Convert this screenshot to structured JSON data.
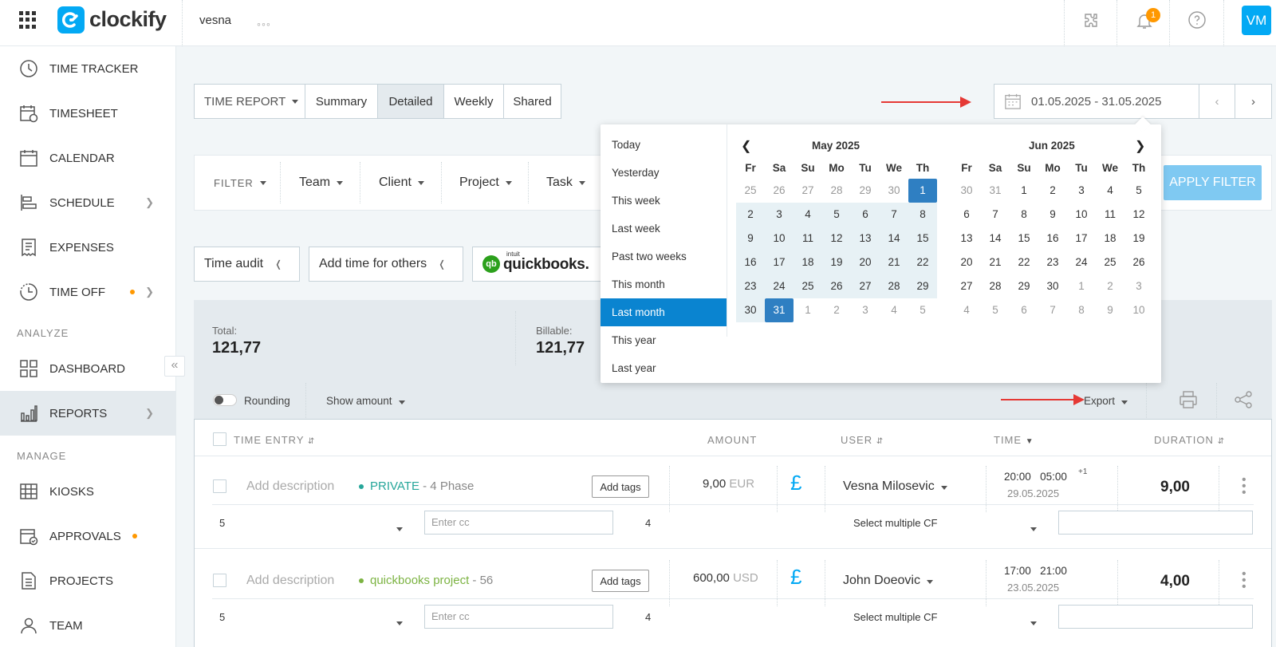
{
  "header": {
    "app_name": "clockify",
    "workspace": "vesna",
    "more": "◦◦◦",
    "notif_count": "1",
    "avatar": "VM"
  },
  "sidebar": {
    "items": [
      {
        "label": "TIME TRACKER",
        "icon": "clock-icon"
      },
      {
        "label": "TIMESHEET",
        "icon": "timesheet-icon"
      },
      {
        "label": "CALENDAR",
        "icon": "calendar-icon"
      },
      {
        "label": "SCHEDULE",
        "icon": "schedule-icon"
      },
      {
        "label": "EXPENSES",
        "icon": "receipt-icon"
      },
      {
        "label": "TIME OFF",
        "icon": "time-off-icon"
      },
      {
        "label": "DASHBOARD",
        "icon": "dashboard-icon"
      },
      {
        "label": "REPORTS",
        "icon": "reports-icon"
      },
      {
        "label": "KIOSKS",
        "icon": "kiosk-icon"
      },
      {
        "label": "APPROVALS",
        "icon": "approvals-icon"
      },
      {
        "label": "PROJECTS",
        "icon": "projects-icon"
      },
      {
        "label": "TEAM",
        "icon": "team-icon"
      }
    ],
    "section_analyze": "ANALYZE",
    "section_manage": "MANAGE",
    "collapse": "«"
  },
  "report": {
    "type_label": "TIME REPORT",
    "tabs": [
      "Summary",
      "Detailed",
      "Weekly",
      "Shared"
    ],
    "active_tab": "Detailed",
    "date_range": "01.05.2025 - 31.05.2025"
  },
  "filter": {
    "label": "FILTER",
    "items": [
      "Team",
      "Client",
      "Project",
      "Task"
    ],
    "apply": "APPLY FILTER"
  },
  "tools": {
    "time_audit": "Time audit",
    "add_time": "Add time for others",
    "qb_intuit": "intuit",
    "qb_name": "quickbooks."
  },
  "totals": {
    "total_label": "Total:",
    "total_value": "121,77",
    "billable_label": "Billable:",
    "billable_value": "121,77"
  },
  "options": {
    "rounding": "Rounding",
    "show_amount": "Show amount",
    "export": "Export"
  },
  "table": {
    "headers": {
      "entry": "TIME ENTRY",
      "amount": "AMOUNT",
      "user": "USER",
      "time": "TIME",
      "duration": "DURATION"
    },
    "rows": [
      {
        "description": "Add description",
        "project": "PRIVATE",
        "task": "- 4 Phase",
        "project_color": "#26a69a",
        "tags": "Add tags",
        "amount": "9,00",
        "currency": "EUR",
        "billable": "£",
        "user": "Vesna Milosevic",
        "start": "20:00",
        "end": "05:00",
        "plus": "+1",
        "date": "29.05.2025",
        "duration": "9,00",
        "cf_num": "5",
        "cf_text": "Enter cc",
        "cf_val": "4",
        "cf_multi": "Select multiple CF"
      },
      {
        "description": "Add description",
        "project": "quickbooks project",
        "task": "- 56",
        "project_color": "#7cb342",
        "tags": "Add tags",
        "amount": "600,00",
        "currency": "USD",
        "billable": "£",
        "user": "John Doeovic",
        "start": "17:00",
        "end": "21:00",
        "plus": "",
        "date": "23.05.2025",
        "duration": "4,00",
        "cf_num": "5",
        "cf_text": "Enter cc",
        "cf_val": "4",
        "cf_multi": "Select multiple CF"
      }
    ]
  },
  "datepicker": {
    "presets": [
      "Today",
      "Yesterday",
      "This week",
      "Last week",
      "Past two weeks",
      "This month",
      "Last month",
      "This year",
      "Last year"
    ],
    "selected_preset": "Last month",
    "weekdays": [
      "Fr",
      "Sa",
      "Su",
      "Mo",
      "Tu",
      "We",
      "Th"
    ],
    "left": {
      "title": "May 2025",
      "weeks": [
        [
          "25",
          "26",
          "27",
          "28",
          "29",
          "30",
          "1"
        ],
        [
          "2",
          "3",
          "4",
          "5",
          "6",
          "7",
          "8"
        ],
        [
          "9",
          "10",
          "11",
          "12",
          "13",
          "14",
          "15"
        ],
        [
          "16",
          "17",
          "18",
          "19",
          "20",
          "21",
          "22"
        ],
        [
          "23",
          "24",
          "25",
          "26",
          "27",
          "28",
          "29"
        ],
        [
          "30",
          "31",
          "1",
          "2",
          "3",
          "4",
          "5"
        ]
      ]
    },
    "right": {
      "title": "Jun 2025",
      "weeks": [
        [
          "30",
          "31",
          "1",
          "2",
          "3",
          "4",
          "5"
        ],
        [
          "6",
          "7",
          "8",
          "9",
          "10",
          "11",
          "12"
        ],
        [
          "13",
          "14",
          "15",
          "16",
          "17",
          "18",
          "19"
        ],
        [
          "20",
          "21",
          "22",
          "23",
          "24",
          "25",
          "26"
        ],
        [
          "27",
          "28",
          "29",
          "30",
          "1",
          "2",
          "3"
        ],
        [
          "4",
          "5",
          "6",
          "7",
          "8",
          "9",
          "10"
        ]
      ]
    }
  },
  "colors": {
    "brand": "#03a9f4",
    "selected": "#0a84d0",
    "range_edge": "#2f7fc2",
    "range_fill": "#e7f1f5",
    "arrow": "#e53935",
    "dot": "#ff9800"
  }
}
